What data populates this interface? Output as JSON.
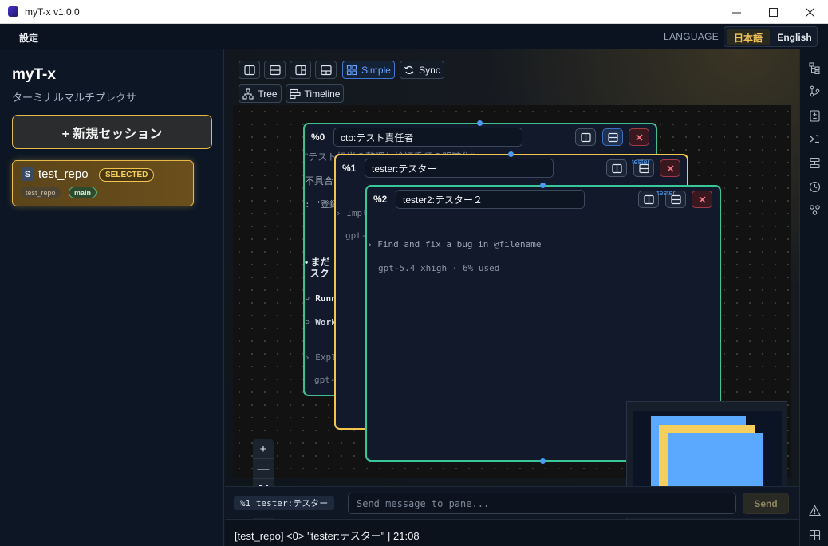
{
  "window": {
    "title": "myT-x v1.0.0",
    "minimize": "—",
    "maximize": "☐",
    "close": "✕"
  },
  "menubar": {
    "settings": "設定",
    "language_label": "LANGUAGE",
    "lang_ja": "日本語",
    "lang_en": "English",
    "active_language": "ja"
  },
  "sidebar": {
    "brand": "myT-x",
    "subtitle": "ターミナルマルチプレクサ",
    "new_session": "+ 新規セッション",
    "sessions": [
      {
        "badge": "S",
        "name": "test_repo",
        "status": "SELECTED",
        "repo": "test_repo",
        "branch": "main"
      }
    ]
  },
  "toolbar": {
    "layout_buttons": [
      "split-vertical-icon",
      "split-horizontal-icon",
      "layout-left-icon",
      "layout-bottom-icon"
    ],
    "simple": "Simple",
    "sync": "Sync",
    "tree": "Tree",
    "timeline": "Timeline"
  },
  "panes": [
    {
      "id": "%0",
      "title": "cto:テスト責任者",
      "border": "#3fbf8f",
      "lines": [
        "\"テスト担当の整理と検証手順の明確化\"",
        "不具合",
        ": \"登録",
        "• まだ",
        "  スク",
        "◦ Runn",
        "◦ Work",
        "› Expl",
        "gpt-"
      ]
    },
    {
      "id": "%1",
      "title": "tester:テスター",
      "border": "#f0c44f",
      "badge": "tester",
      "lines": [
        "› Impl",
        "gpt-"
      ]
    },
    {
      "id": "%2",
      "title": "tester2:テスター２",
      "border": "#39c79a",
      "badge": "tester",
      "lines": [
        "› Find and fix a bug in @filename",
        "gpt-5.4 xhigh · 6% used"
      ]
    }
  ],
  "zoom": {
    "in": "+",
    "out": "—",
    "fit": "fit-view-icon",
    "lock": "lock-icon"
  },
  "colors": {
    "accent": "#e7b949",
    "active_blue": "#4c9cf1",
    "minimap_pane": "#5aa8ff",
    "minimap_selected": "#f5cf5e"
  },
  "input": {
    "target": "%1 tester:テスター",
    "placeholder": "Send message to pane...",
    "value": "",
    "send": "Send"
  },
  "status": "[test_repo] <0> \"tester:テスター\" | 21:08",
  "rightrail": [
    "tree-icon",
    "git-branch-icon",
    "diff-icon",
    "terminal-icon",
    "layout-icon",
    "history-icon",
    "team-icon",
    "warning-icon",
    "grid-icon"
  ]
}
